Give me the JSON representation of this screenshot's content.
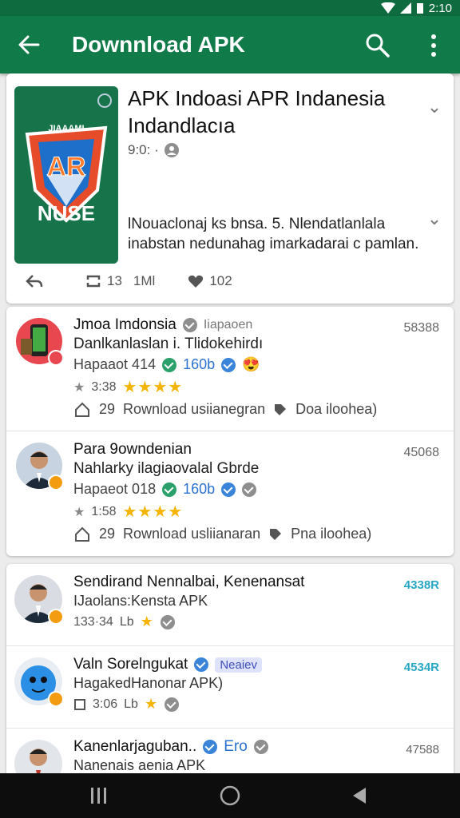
{
  "status_bar": {
    "time": "2:10"
  },
  "app_bar": {
    "title": "Downnload APK"
  },
  "featured": {
    "title": "APK Indoasi APR Indanesia Indandlacıa",
    "meta": "9:0: ·",
    "description": "lNouaclonaj ks bnsa. 5. Nlendatlanlala inabstan nedunahag imarkadarai c pamlan.",
    "icon_text_top": "JIAAAMI",
    "icon_text_mid": "AR",
    "icon_text_bottom": "NUSE",
    "actions": {
      "reply": "",
      "repost_count": "13",
      "views": "1Ml",
      "likes": "102"
    }
  },
  "list_primary": [
    {
      "title": "Jmoa Imdonsia",
      "handle": "Iiapaoen",
      "subtitle": "Danlkanlaslan i. Tlidokehirdı",
      "line3_text": "Hapaaot 414",
      "line3_stat": "160b",
      "rating_label": "3:38",
      "stars": "★★★★",
      "reply_count": "29",
      "action": "Rownload usiianegran",
      "action2": "Doa iloohea)",
      "count": "58388",
      "avatar_bg": "#e8474f"
    },
    {
      "title": "Para 9owndenian",
      "handle": "",
      "subtitle": "Nahlarky ilagiaovalal Gbrde",
      "line3_text": "Hapaeot 018",
      "line3_stat": "160b",
      "rating_label": "1:58",
      "stars": "★★★★",
      "reply_count": "29",
      "action": "Rownload usliianaran",
      "action2": "Pna iloohea)",
      "count": "45068",
      "avatar_bg": "#c7d3e0"
    }
  ],
  "list_secondary": [
    {
      "title": "Sendirand Nennalbai, Kenenansat",
      "subtitle": "IJaolans:Kensta APK",
      "line3_text": "133·34",
      "line3_short": "Lb",
      "count": "4338R",
      "count_style": "blue"
    },
    {
      "title": "Valn Sorelngukat",
      "tag": "Neaiev",
      "subtitle": "HagakedHanonar APK)",
      "line3_text": "3:06",
      "line3_short": "Lb",
      "count": "4534R",
      "count_style": "blue"
    },
    {
      "title": "Kanenlarjaguban..",
      "tag2": "Ero",
      "subtitle": "Nanenais aenia APK",
      "line3_text": "",
      "line3_short": "",
      "count": "47588",
      "count_style": "grey"
    }
  ]
}
